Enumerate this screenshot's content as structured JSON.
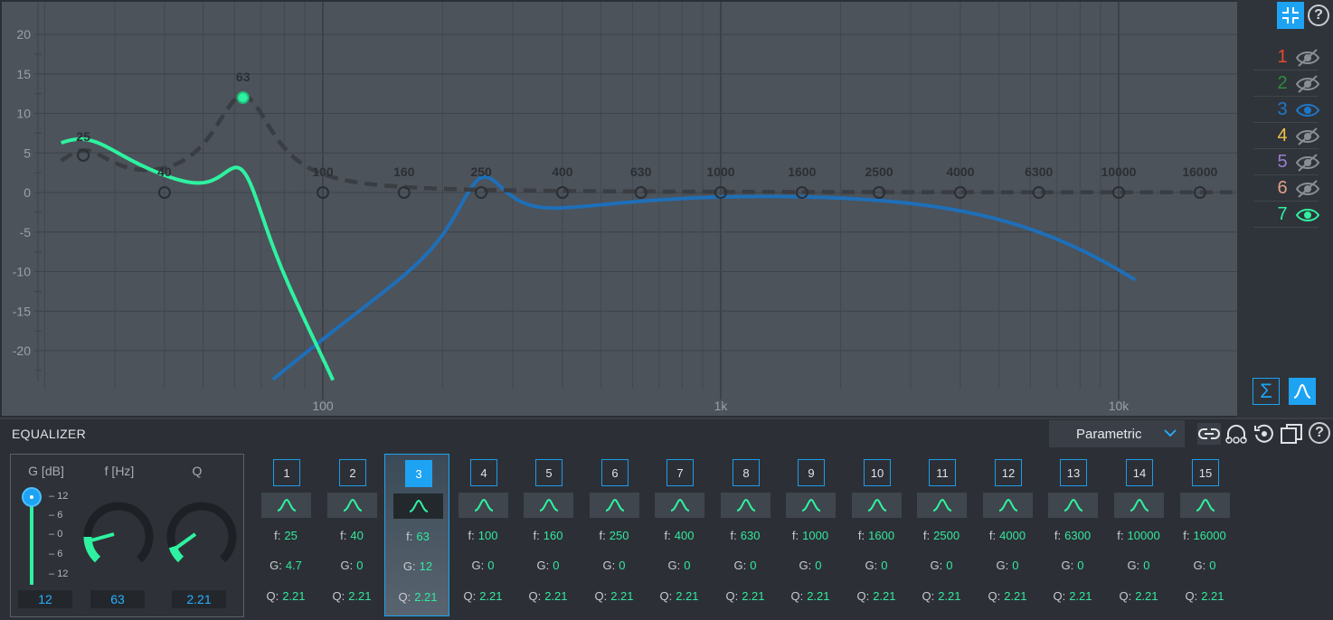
{
  "graph": {
    "y_ticks": [
      "20",
      "15",
      "10",
      "5",
      "0",
      "-5",
      "-10",
      "-15",
      "-20"
    ],
    "x_ticks": [
      "100",
      "1k",
      "10k"
    ],
    "freq_labels": [
      "25",
      "40",
      "63",
      "100",
      "160",
      "250",
      "400",
      "630",
      "1000",
      "1600",
      "2500",
      "4000",
      "6300",
      "10000",
      "16000"
    ],
    "active_point": {
      "freq": 63,
      "gain": 12
    },
    "curves": [
      {
        "name": "7",
        "color": "#2ef2a0"
      },
      {
        "name": "3",
        "color": "#1e6fb8"
      },
      {
        "name": "sum",
        "color": "#3a3d42"
      }
    ]
  },
  "right_panel": {
    "layers": [
      {
        "num": "1",
        "color": "#e84a2c",
        "visible": false
      },
      {
        "num": "2",
        "color": "#2e8c3e",
        "visible": false
      },
      {
        "num": "3",
        "color": "#1f77c9",
        "visible": true
      },
      {
        "num": "4",
        "color": "#f0c14a",
        "visible": false
      },
      {
        "num": "5",
        "color": "#9b7fd0",
        "visible": false
      },
      {
        "num": "6",
        "color": "#e0a088",
        "visible": false
      },
      {
        "num": "7",
        "color": "#2ef2a0",
        "visible": true
      }
    ],
    "sum_label": "Σ"
  },
  "equalizer": {
    "title": "EQUALIZER",
    "mode": "Parametric",
    "knobs": {
      "gain_label": "G [dB]",
      "freq_label": "f [Hz]",
      "q_label": "Q",
      "gain_value": "12",
      "freq_value": "63",
      "q_value": "2.21",
      "scale": [
        "12",
        "6",
        "0",
        "6",
        "12"
      ]
    },
    "bands": [
      {
        "num": "1",
        "f": "25",
        "g": "4.7",
        "q": "2.21"
      },
      {
        "num": "2",
        "f": "40",
        "g": "0",
        "q": "2.21"
      },
      {
        "num": "3",
        "f": "63",
        "g": "12",
        "q": "2.21"
      },
      {
        "num": "4",
        "f": "100",
        "g": "0",
        "q": "2.21"
      },
      {
        "num": "5",
        "f": "160",
        "g": "0",
        "q": "2.21"
      },
      {
        "num": "6",
        "f": "250",
        "g": "0",
        "q": "2.21"
      },
      {
        "num": "7",
        "f": "400",
        "g": "0",
        "q": "2.21"
      },
      {
        "num": "8",
        "f": "630",
        "g": "0",
        "q": "2.21"
      },
      {
        "num": "9",
        "f": "1000",
        "g": "0",
        "q": "2.21"
      },
      {
        "num": "10",
        "f": "1600",
        "g": "0",
        "q": "2.21"
      },
      {
        "num": "11",
        "f": "2500",
        "g": "0",
        "q": "2.21"
      },
      {
        "num": "12",
        "f": "4000",
        "g": "0",
        "q": "2.21"
      },
      {
        "num": "13",
        "f": "6300",
        "g": "0",
        "q": "2.21"
      },
      {
        "num": "14",
        "f": "10000",
        "g": "0",
        "q": "2.21"
      },
      {
        "num": "15",
        "f": "16000",
        "g": "0",
        "q": "2.21"
      }
    ],
    "row_keys": {
      "f": "f:",
      "g": "G:",
      "q": "Q:"
    },
    "selected_band": 3
  }
}
